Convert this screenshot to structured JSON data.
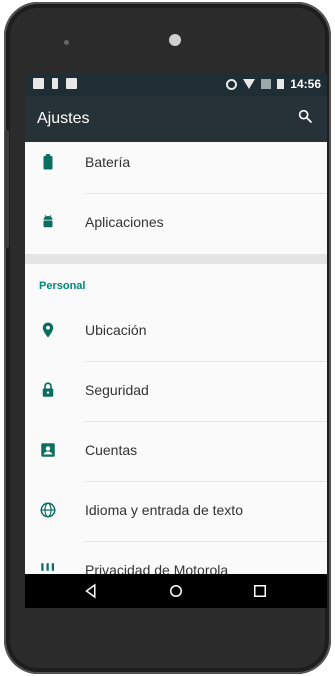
{
  "statusbar": {
    "time": "14:56"
  },
  "appbar": {
    "title": "Ajustes",
    "search_icon": "search-icon"
  },
  "items_top": [
    {
      "label": "Batería",
      "icon": "battery-icon"
    },
    {
      "label": "Aplicaciones",
      "icon": "android-icon"
    }
  ],
  "section": {
    "title": "Personal"
  },
  "items_personal": [
    {
      "label": "Ubicación",
      "icon": "location-pin-icon"
    },
    {
      "label": "Seguridad",
      "icon": "lock-icon"
    },
    {
      "label": "Cuentas",
      "icon": "account-box-icon"
    },
    {
      "label": "Idioma y entrada de texto",
      "icon": "globe-icon"
    },
    {
      "label": "Privacidad de Motorola",
      "icon": "privacy-icon"
    }
  ],
  "colors": {
    "appbar": "#263238",
    "statusbar": "#1f2d34",
    "accent": "#00897b",
    "icon": "#0b6e5f"
  }
}
